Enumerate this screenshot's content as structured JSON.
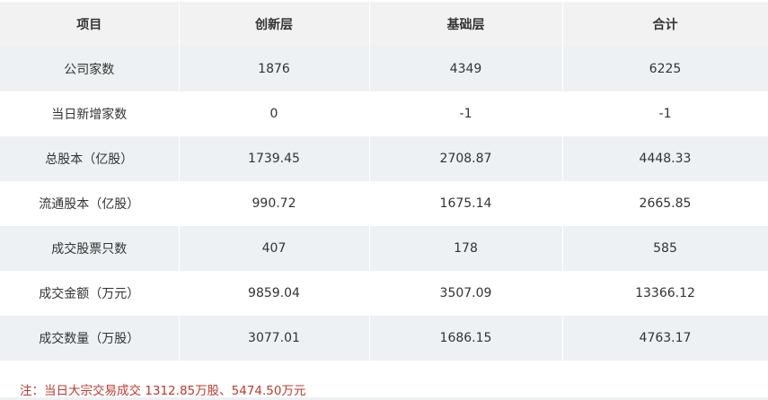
{
  "table": {
    "headers": [
      "项目",
      "创新层",
      "基础层",
      "合计"
    ],
    "rows": [
      [
        "公司家数",
        "1876",
        "4349",
        "6225"
      ],
      [
        "当日新增家数",
        "0",
        "-1",
        "-1"
      ],
      [
        "总股本（亿股）",
        "1739.45",
        "2708.87",
        "4448.33"
      ],
      [
        "流通股本（亿股）",
        "990.72",
        "1675.14",
        "2665.85"
      ],
      [
        "成交股票只数",
        "407",
        "178",
        "585"
      ],
      [
        "成交金额（万元）",
        "9859.04",
        "3507.09",
        "13366.12"
      ],
      [
        "成交数量（万股）",
        "3077.01",
        "1686.15",
        "4763.17"
      ]
    ]
  },
  "note": "注：当日大宗交易成交 1312.85万股、5474.50万元",
  "colors": {
    "header_bg": "#f2f2f2",
    "stripe_bg": "#edf1f3",
    "note_text": "#c0392b"
  }
}
